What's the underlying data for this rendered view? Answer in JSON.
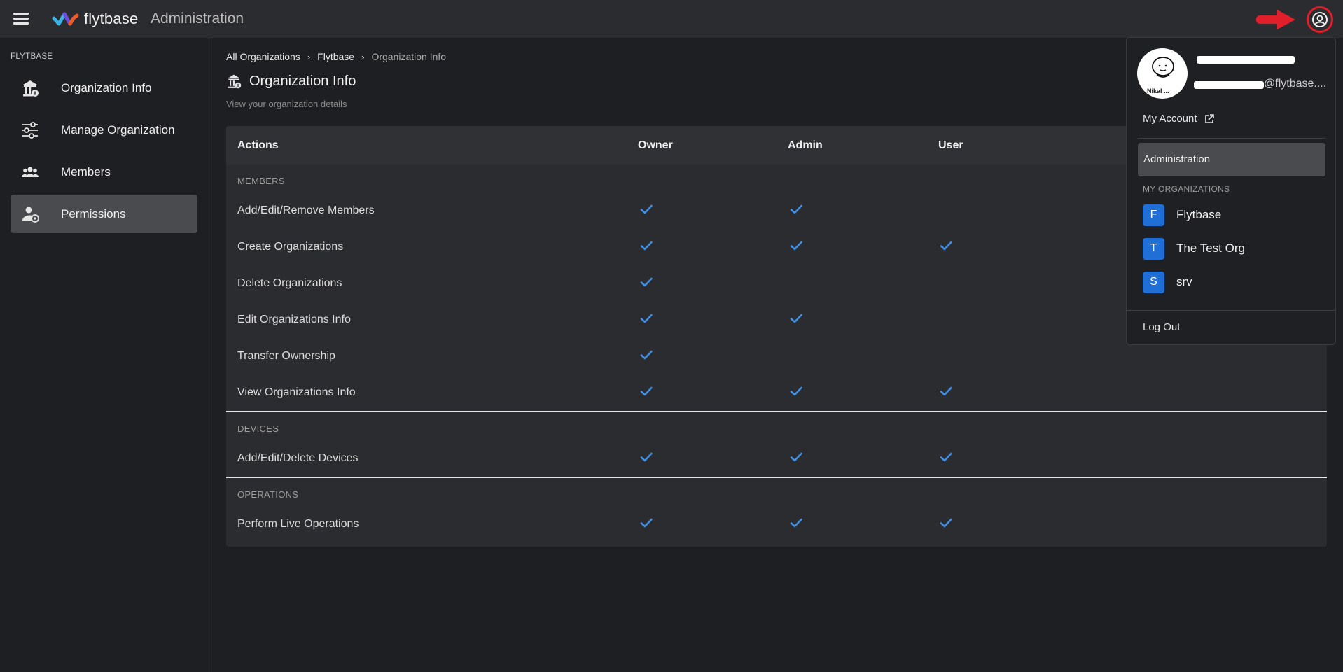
{
  "header": {
    "logo_text": "flytbase",
    "app_title": "Administration",
    "icons": {
      "menu": "hamburger-menu-icon",
      "arrow": "red-arrow-icon",
      "account": "account-circle-icon"
    },
    "colors": {
      "arrow": "#e01f2a",
      "highlight_ring": "#e01f2a"
    }
  },
  "sidebar": {
    "section_label": "FLYTBASE",
    "items": [
      {
        "label": "Organization Info",
        "icon": "organization-icon",
        "active": false
      },
      {
        "label": "Manage Organization",
        "icon": "sliders-icon",
        "active": false
      },
      {
        "label": "Members",
        "icon": "members-icon",
        "active": false
      },
      {
        "label": "Permissions",
        "icon": "permissions-icon",
        "active": true
      }
    ]
  },
  "breadcrumb": [
    "All Organizations",
    "Flytbase",
    "Organization Info"
  ],
  "page": {
    "title": "Organization Info",
    "subtitle": "View your organization details",
    "title_icon": "organization-icon"
  },
  "table": {
    "headers": [
      "Actions",
      "Owner",
      "Admin",
      "User"
    ],
    "check_color": "#3d8fe8",
    "sections": [
      {
        "label": "MEMBERS",
        "rows": [
          {
            "action": "Add/Edit/Remove Members",
            "owner": true,
            "admin": true,
            "user": false
          },
          {
            "action": "Create Organizations",
            "owner": true,
            "admin": true,
            "user": true
          },
          {
            "action": "Delete Organizations",
            "owner": true,
            "admin": false,
            "user": false
          },
          {
            "action": "Edit Organizations Info",
            "owner": true,
            "admin": true,
            "user": false
          },
          {
            "action": "Transfer Ownership",
            "owner": true,
            "admin": false,
            "user": false
          },
          {
            "action": "View Organizations Info",
            "owner": true,
            "admin": true,
            "user": true
          }
        ]
      },
      {
        "label": "DEVICES",
        "rows": [
          {
            "action": "Add/Edit/Delete Devices",
            "owner": true,
            "admin": true,
            "user": true
          }
        ]
      },
      {
        "label": "OPERATIONS",
        "rows": [
          {
            "action": "Perform Live Operations",
            "owner": true,
            "admin": true,
            "user": true
          }
        ]
      }
    ]
  },
  "account_menu": {
    "avatar_caption": "Nikal ...",
    "email_suffix": "@flytbase....",
    "my_account": "My Account",
    "my_account_icon": "external-link-icon",
    "administration": "Administration",
    "orgs_heading": "MY ORGANIZATIONS",
    "orgs": [
      {
        "initial": "F",
        "name": "Flytbase"
      },
      {
        "initial": "T",
        "name": "The Test Org"
      },
      {
        "initial": "S",
        "name": "srv"
      }
    ],
    "logout": "Log Out",
    "org_badge_color": "#1f6fd6"
  }
}
